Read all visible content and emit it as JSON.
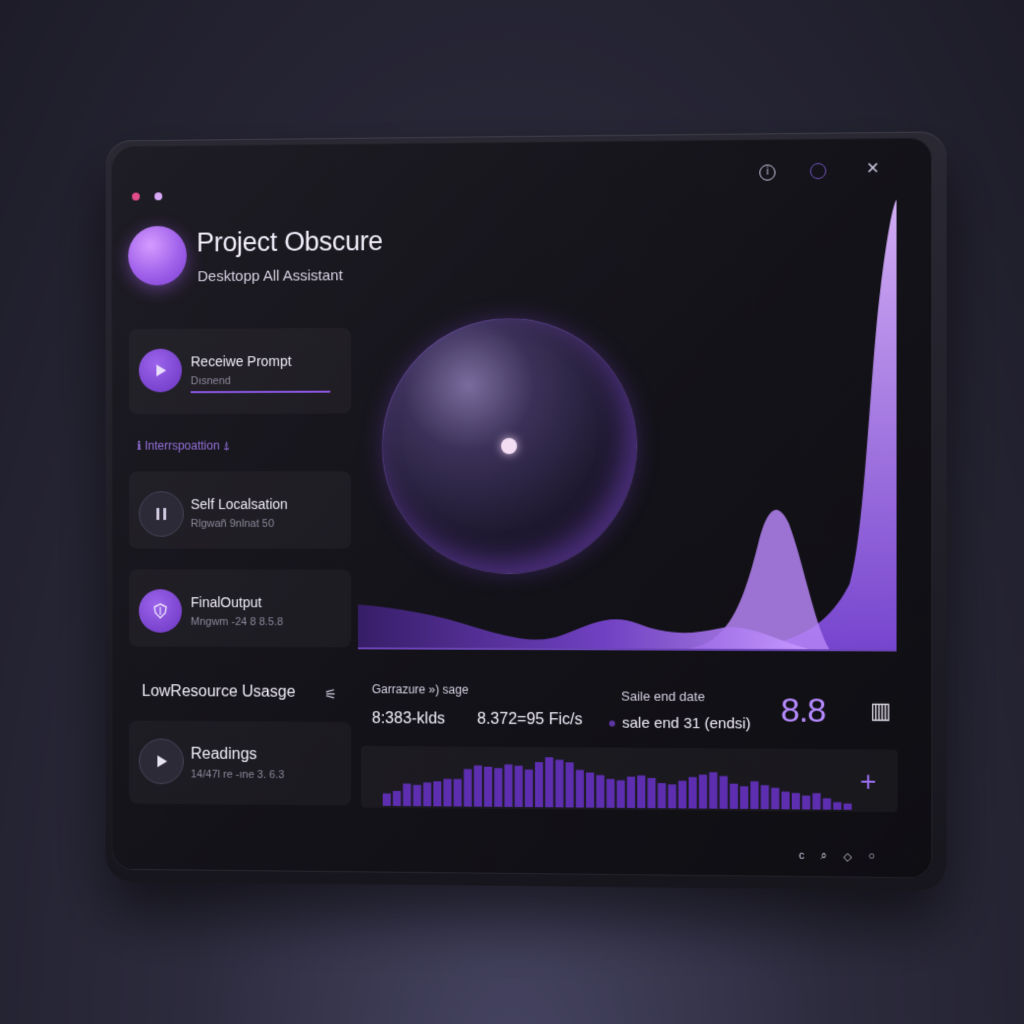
{
  "app": {
    "title": "Project Obscure",
    "subtitle": "Desktopp All Assistant"
  },
  "window_controls": [
    "info-icon",
    "circle-icon",
    "close-icon"
  ],
  "window_controls_glyphs": {
    "info": "i",
    "close": "✕"
  },
  "steps": [
    {
      "label": "Receiwe Prompt",
      "sub": "Dısnend",
      "icon": "play-icon",
      "progress": 1.0
    },
    {
      "label": "Self Localsation",
      "sub": "Rlgwañ 9nlnat 50",
      "icon": "pause-icon"
    },
    {
      "label": "FinalOutput",
      "sub": "Mngwm -24 8 8.5.8",
      "icon": "shield-icon"
    }
  ],
  "section_note": "ℹ Interrspoattion ⍋",
  "low_resource": {
    "title": "LowResource Usasge",
    "icon": "sliders-icon",
    "icon_glyph": "⚟"
  },
  "readings": {
    "label": "Readings",
    "sub": "14/47l re -ıne 3. 6.3",
    "icon": "play-icon"
  },
  "stats": {
    "garrazure_label": "Garrazure ») sage",
    "garrazure_value1": "8:383-klds",
    "garrazure_value2": "8.372=95 Fic/s",
    "sale_label": "Saile end date",
    "sale_value": "sale end 31 (endsi)",
    "big_number": "8.8"
  },
  "bars_icon": "bar-chart-icon",
  "bars_glyph": "▥",
  "plus_glyph": "+",
  "bottom_icons": [
    "c",
    "🔍",
    "◇",
    "○"
  ],
  "colors": {
    "accent": "#9c6ef0",
    "accent_light": "#c28cff",
    "bar": "#5d2fb0"
  },
  "mini_chart_values": [
    10,
    12,
    18,
    17,
    19,
    20,
    22,
    22,
    30,
    33,
    32,
    31,
    34,
    33,
    30,
    36,
    40,
    38,
    36,
    30,
    28,
    26,
    23,
    22,
    25,
    26,
    24,
    20,
    19,
    22,
    25,
    27,
    29,
    26,
    20,
    18,
    22,
    19,
    17,
    14,
    13,
    11,
    13,
    9,
    6,
    5
  ]
}
